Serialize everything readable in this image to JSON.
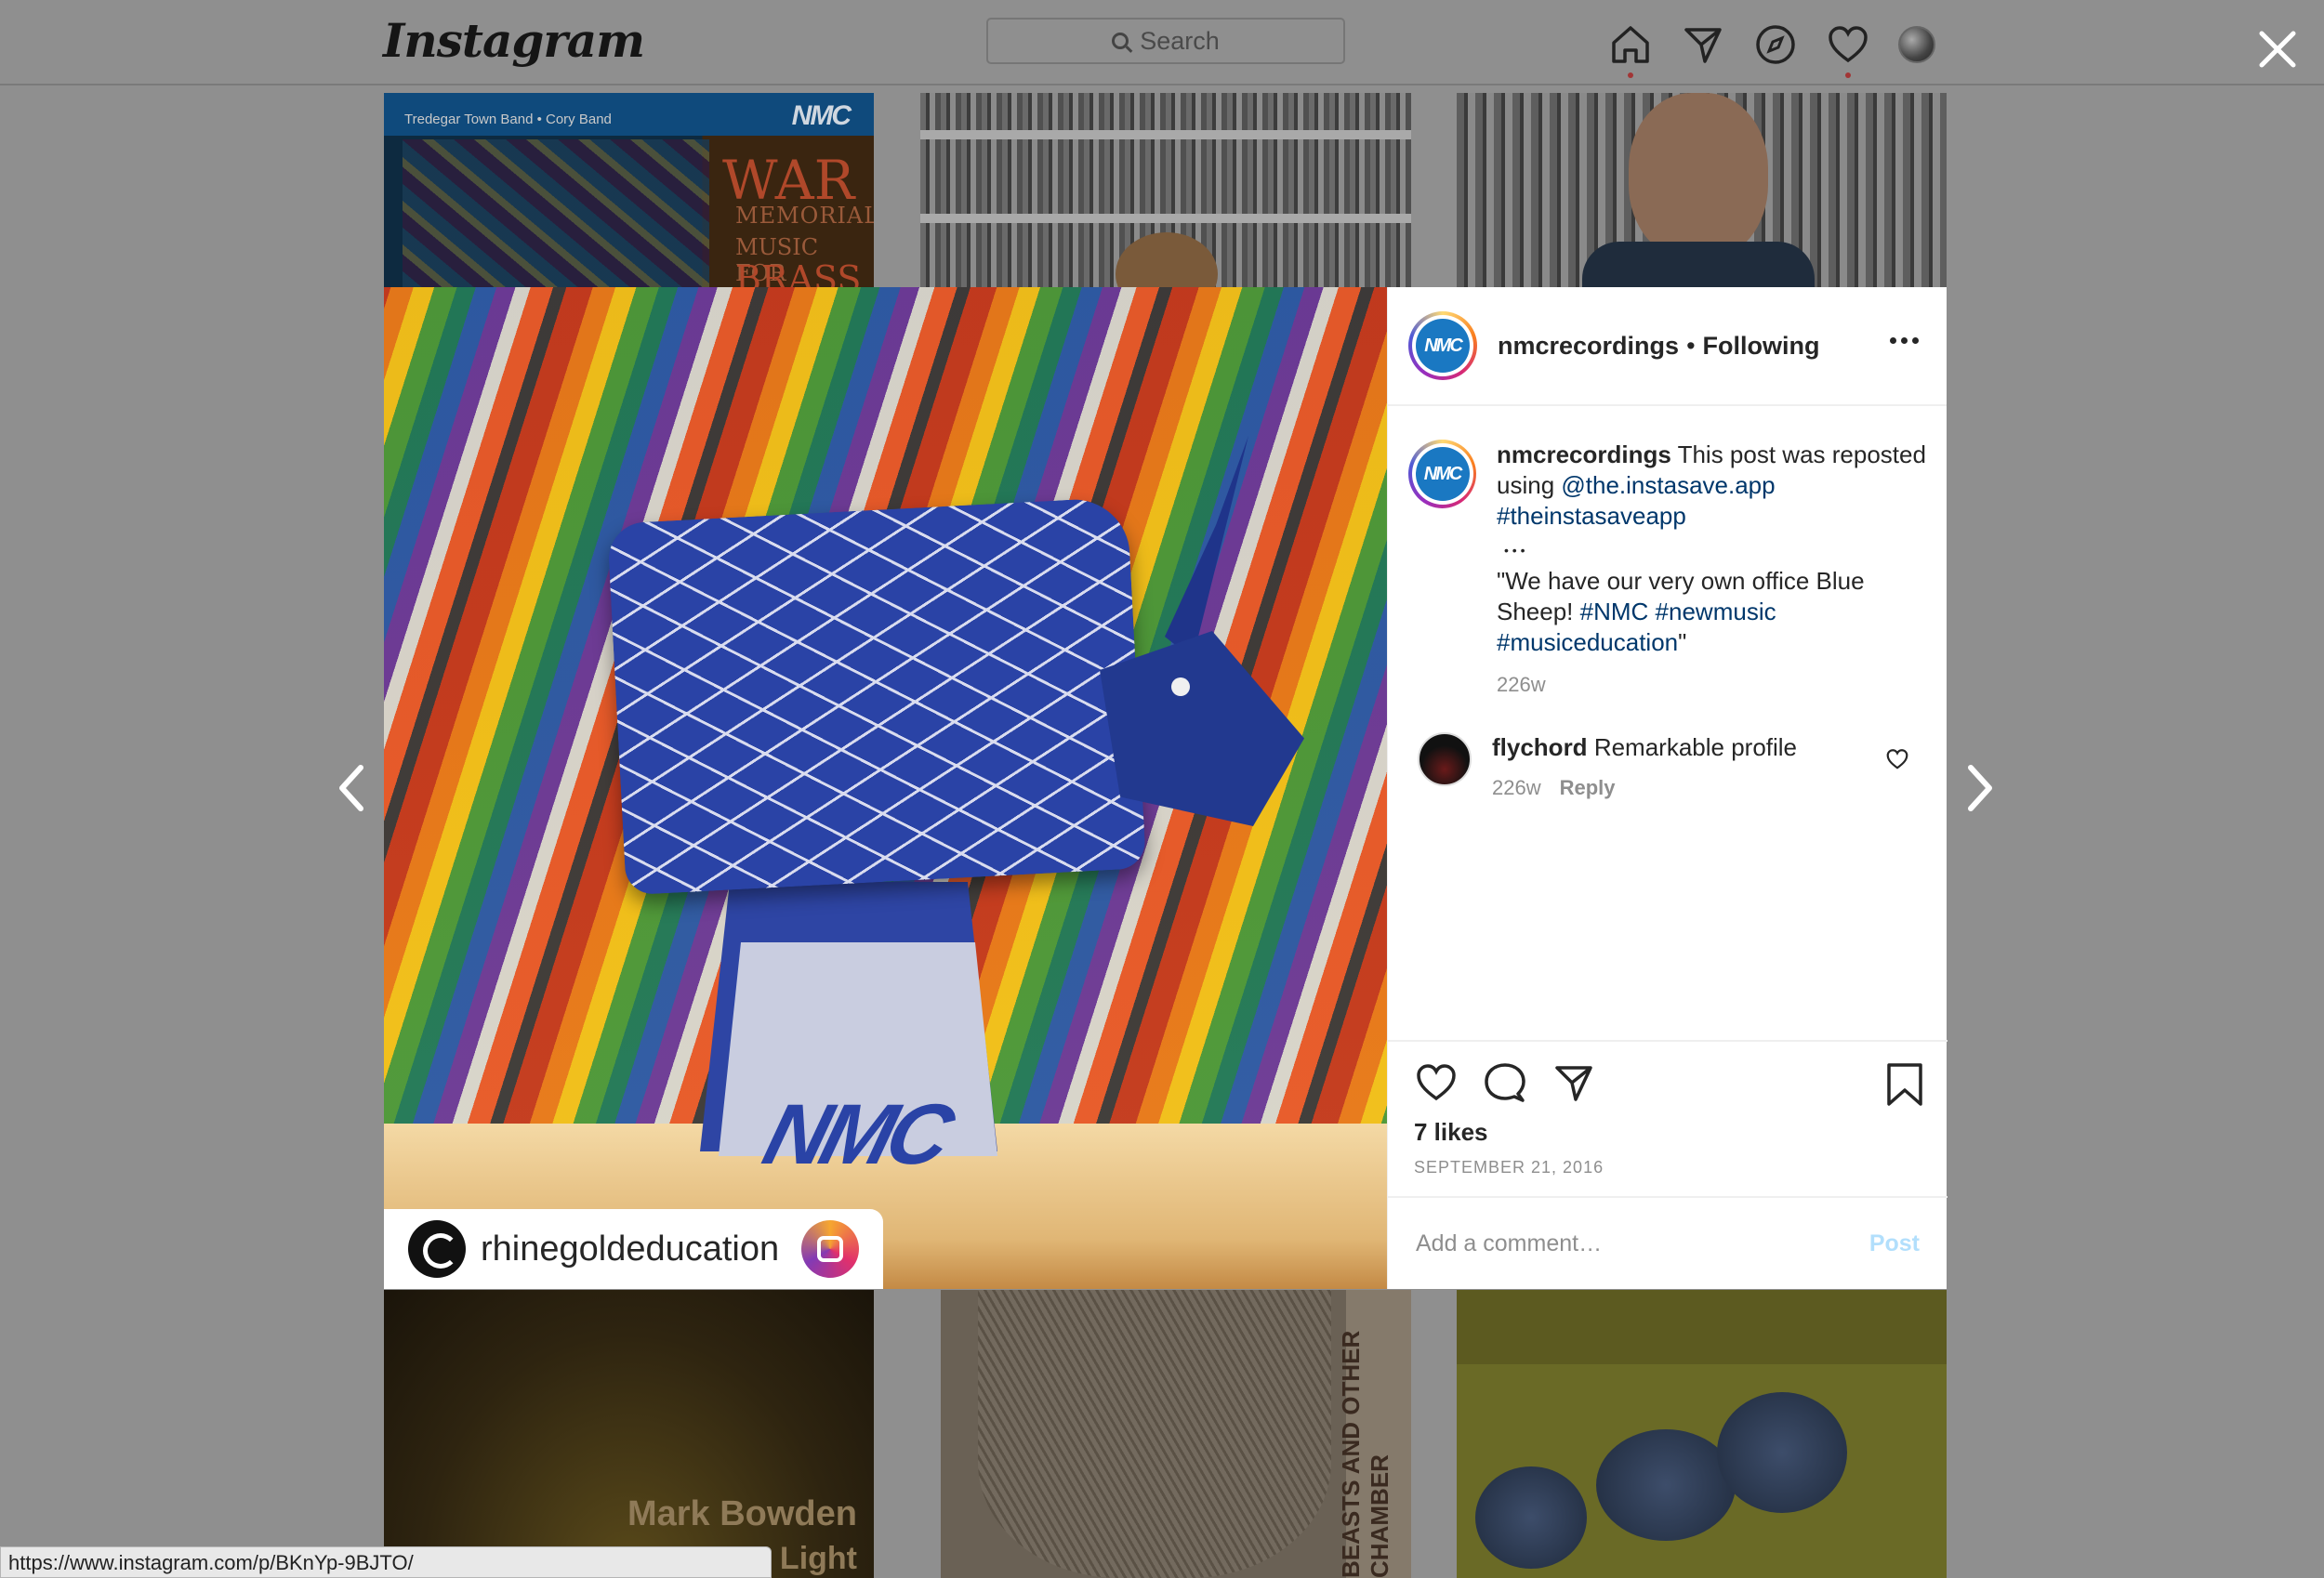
{
  "app": {
    "logo": "Instagram"
  },
  "search": {
    "placeholder": "Search"
  },
  "nav": {
    "icons": [
      "home-icon",
      "direct-icon",
      "explore-icon",
      "activity-heart-icon",
      "profile-avatar"
    ]
  },
  "background_tiles": {
    "t1": {
      "band": "Tredegar Town Band • Cory Band",
      "logo": "NMC",
      "war": "WAR",
      "memorials": "MEMORIALS",
      "music_for": "MUSIC FOR",
      "brass": "BRASS"
    },
    "t4": {
      "line1": "Mark Bowden",
      "line2": "en Light"
    },
    "t5": {
      "vertical": "BEASTS AND OTHER CHAMBER"
    }
  },
  "photo": {
    "logo_text": "NMC",
    "credit_username": "rhinegoldeducation"
  },
  "post": {
    "username": "nmcrecordings",
    "follow_sep": "•",
    "follow_status": "Following",
    "caption": {
      "username": "nmcrecordings",
      "text1": "This post was reposted using",
      "mention": "@the.instasave.app",
      "hashtag1": "#theinstasaveapp",
      "dots": "• • •",
      "quote_start": "\"We have our very own office Blue Sheep!",
      "tag_nmc": "#NMC",
      "tag_newmusic": "#newmusic",
      "tag_musiceducation": "#musiceducation",
      "quote_end": "\"",
      "time": "226w"
    },
    "comments": [
      {
        "username": "flychord",
        "text": "Remarkable profile",
        "time": "226w",
        "reply": "Reply"
      }
    ],
    "likes": "7 likes",
    "date": "SEPTEMBER 21, 2016",
    "comment_placeholder": "Add a comment…",
    "post_label": "Post"
  },
  "status_bar": {
    "url": "https://www.instagram.com/p/BKnYp-9BJTO/"
  },
  "colors": {
    "link": "#00376b",
    "post_disabled": "#b2dffc",
    "muted": "#8e8e8e"
  }
}
